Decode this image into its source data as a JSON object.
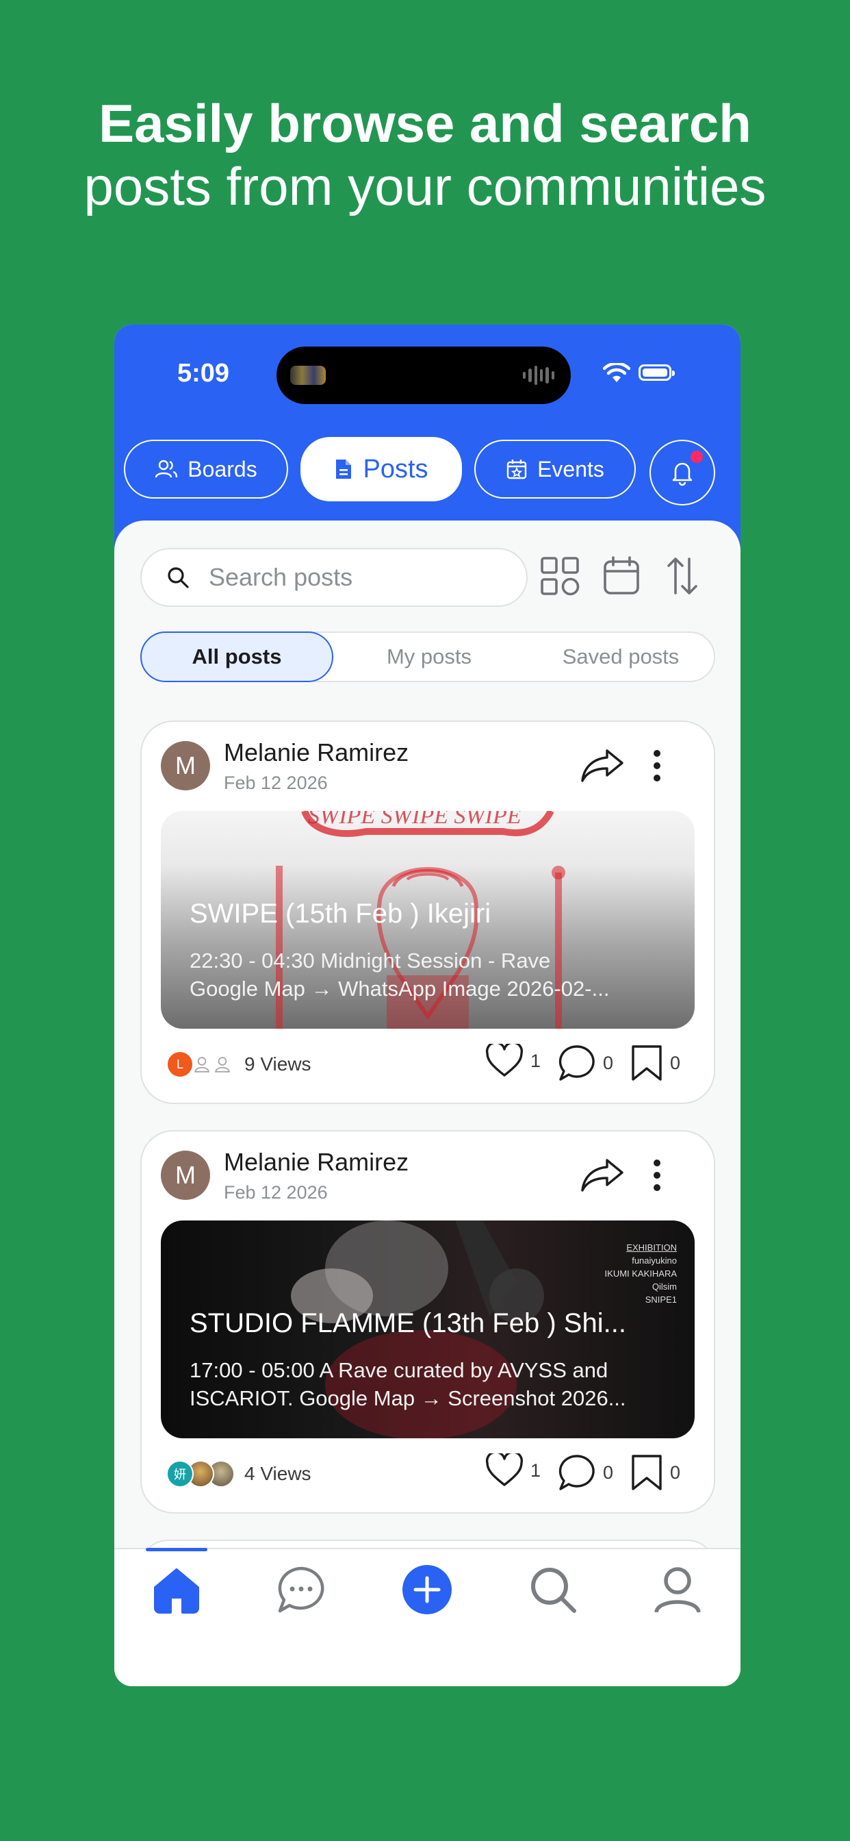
{
  "headline": {
    "line1": "Easily browse and search",
    "line2": "posts from your communities"
  },
  "status_bar": {
    "time": "5:09"
  },
  "top_tabs": [
    {
      "label": "Boards",
      "icon": "people-icon",
      "active": false
    },
    {
      "label": "Posts",
      "icon": "document-icon",
      "active": true
    },
    {
      "label": "Events",
      "icon": "calendar-star-icon",
      "active": false
    }
  ],
  "notification": {
    "icon": "bell-icon",
    "has_unread": true,
    "dot_color": "#ff2a63"
  },
  "search": {
    "placeholder": "Search posts"
  },
  "toolbar_icons": [
    "grid-view-icon",
    "calendar-icon",
    "sort-icon"
  ],
  "filters": [
    {
      "label": "All posts",
      "active": true
    },
    {
      "label": "My posts",
      "active": false
    },
    {
      "label": "Saved posts",
      "active": false
    }
  ],
  "posts": [
    {
      "author": "Melanie Ramirez",
      "avatar_letter": "M",
      "date": "Feb 12 2026",
      "title": "SWIPE (15th Feb ) Ikejiri",
      "desc_line1": "22:30 - 04:30 Midnight Session - Rave",
      "desc_line2": "Google Map → WhatsApp Image 2026-02-...",
      "views": "9 Views",
      "likes": "1",
      "comments": "0",
      "saves": "0",
      "viewer_avatar_letter": "L"
    },
    {
      "author": "Melanie Ramirez",
      "avatar_letter": "M",
      "date": "Feb 12 2026",
      "title": "STUDIO FLAMME (13th Feb ) Shi...",
      "desc_line1": "17:00 - 05:00 A Rave curated by AVYSS and",
      "desc_line2": "ISCARIOT. Google Map → Screenshot 2026...",
      "views": "4 Views",
      "likes": "1",
      "comments": "0",
      "saves": "0",
      "viewer_avatar_letter": "妍",
      "poster_lines": [
        "EXHIBITION",
        "funaiyukino",
        "IKUMI KAKIHARA",
        "Qilsim",
        "SNIPE1"
      ]
    }
  ],
  "bottom_nav": [
    {
      "name": "home",
      "icon": "home-icon",
      "active": true
    },
    {
      "name": "chat",
      "icon": "chat-bubble-icon",
      "active": false
    },
    {
      "name": "create",
      "icon": "plus-circle-icon",
      "active": false
    },
    {
      "name": "search",
      "icon": "search-icon",
      "active": false
    },
    {
      "name": "profile",
      "icon": "person-icon",
      "active": false
    }
  ],
  "colors": {
    "background": "#229651",
    "accent": "#2a62f4",
    "card_border": "#dfe1e3"
  }
}
